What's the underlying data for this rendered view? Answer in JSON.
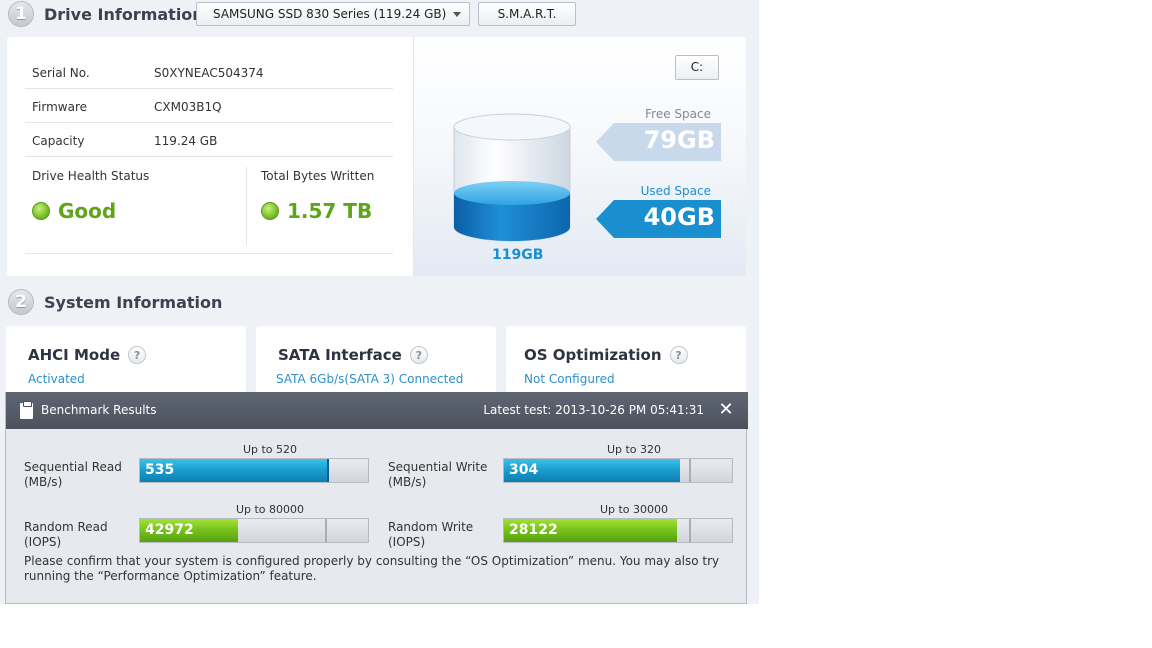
{
  "drive_section": {
    "number": "1",
    "title": "Drive Information",
    "selected_drive": "SAMSUNG SSD 830 Series  (119.24 GB)",
    "smart_button": "S.M.A.R.T."
  },
  "drive_info": {
    "serial_label": "Serial No.",
    "serial_value": "S0XYNEAC504374",
    "firmware_label": "Firmware",
    "firmware_value": "CXM03B1Q",
    "capacity_label": "Capacity",
    "capacity_value": "119.24 GB",
    "health_label": "Drive Health Status",
    "health_value": "Good",
    "tbw_label": "Total Bytes Written",
    "tbw_value": "1.57 TB"
  },
  "capacity": {
    "drive_letter_button": "C:",
    "free_label": "Free Space",
    "free_value": "79GB",
    "used_label": "Used Space",
    "used_value": "40GB",
    "total_value": "119GB",
    "used_fraction": 0.34,
    "colors": {
      "used": "#1a8fcf",
      "free": "#c9d9ec"
    }
  },
  "system_section": {
    "number": "2",
    "title": "System Information",
    "cards": [
      {
        "title": "AHCI Mode",
        "help": "?",
        "status": "Activated"
      },
      {
        "title": "SATA Interface",
        "help": "?",
        "status": "SATA 6Gb/s(SATA 3) Connected"
      },
      {
        "title": "OS Optimization",
        "help": "?",
        "status": "Not Configured"
      }
    ]
  },
  "benchmark": {
    "title": "Benchmark Results",
    "latest": "Latest test: 2013-10-26 PM 05:41:31",
    "close": "✕",
    "metrics": [
      {
        "label_line1": "Sequential Read",
        "label_line2": "(MB/s)",
        "upto": "Up to 520",
        "value": "535",
        "fraction": 0.82,
        "mark": 0.82,
        "color": "blue"
      },
      {
        "label_line1": "Sequential Write",
        "label_line2": "(MB/s)",
        "upto": "Up to 320",
        "value": "304",
        "fraction": 0.77,
        "mark": 0.81,
        "color": "blue"
      },
      {
        "label_line1": "Random Read",
        "label_line2": "(IOPS)",
        "upto": "Up to 80000",
        "value": "42972",
        "fraction": 0.43,
        "mark": 0.81,
        "color": "green"
      },
      {
        "label_line1": "Random Write",
        "label_line2": "(IOPS)",
        "upto": "Up to 30000",
        "value": "28122",
        "fraction": 0.76,
        "mark": 0.81,
        "color": "green"
      }
    ],
    "note": "Please confirm that your system is configured properly by consulting the “OS Optimization” menu. You may also try running the “Performance Optimization” feature."
  }
}
